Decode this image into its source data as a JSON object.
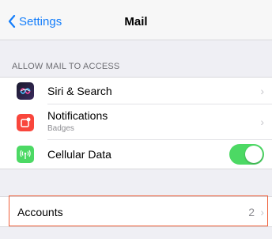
{
  "nav": {
    "back_label": "Settings",
    "title": "Mail"
  },
  "section": {
    "header": "ALLOW MAIL TO ACCESS"
  },
  "rows": {
    "siri": {
      "label": "Siri & Search"
    },
    "notifications": {
      "label": "Notifications",
      "sublabel": "Badges"
    },
    "cellular": {
      "label": "Cellular Data",
      "toggle_on": true
    }
  },
  "accounts": {
    "label": "Accounts",
    "count": "2"
  },
  "colors": {
    "accent": "#147efb",
    "toggle_on": "#4cd964",
    "highlight": "#f0603b"
  },
  "icons": {
    "siri": "siri-icon",
    "notifications": "notifications-icon",
    "cellular": "cellular-antenna-icon"
  }
}
